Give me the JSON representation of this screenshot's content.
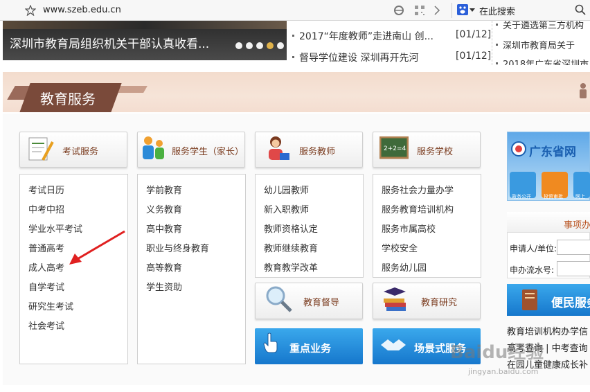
{
  "browser": {
    "url": "www.szeb.edu.cn",
    "search_placeholder": "在此搜索"
  },
  "top_news": {
    "banner_caption": "深圳市教育局组织机关干部认真收看...",
    "middle": [
      {
        "title": "2017“年度教师”走进南山 创...",
        "date": "[01/12]"
      },
      {
        "title": "督导学位建设 深圳再开先河",
        "date": "[01/12]"
      }
    ],
    "right": [
      "关于遴选第三方机构",
      "深圳市教育局关于",
      "2018年广东省深圳市"
    ]
  },
  "section": {
    "title": "教育服务"
  },
  "categories": [
    {
      "label": "考试服务",
      "items": [
        "考试日历",
        "中考中招",
        "学业水平考试",
        "普通高考",
        "成人高考",
        "自学考试",
        "研究生考试",
        "社会考试"
      ]
    },
    {
      "label": "服务学生（家长）",
      "items": [
        "学前教育",
        "义务教育",
        "高中教育",
        "职业与终身教育",
        "高等教育",
        "学生资助"
      ]
    },
    {
      "label": "服务教师",
      "items": [
        "幼儿园教师",
        "新入职教师",
        "教师资格认定",
        "教师继续教育",
        "教育教学改革"
      ]
    },
    {
      "label": "服务学校",
      "items": [
        "服务社会力量办学",
        "服务教育培训机构",
        "服务市属高校",
        "学校安全",
        "服务幼儿园"
      ]
    }
  ],
  "secondary": {
    "supervision": "教育督导",
    "research": "教育研究",
    "key_business": "重点业务",
    "scenario_service": "场景式服务"
  },
  "right_panel": {
    "gd_title": "广东省网",
    "mini_icons": [
      "政务公开",
      "投资审批",
      "网上"
    ],
    "query_title": "事项办",
    "applicant_label": "申请人/单位:",
    "serial_label": "申办流水号:",
    "convenience": "便民服务",
    "links": [
      "教育培训机构办学信",
      "高考查询 | 中考查询",
      "在园儿童健康成长补"
    ]
  },
  "watermark": {
    "main": "Baidu经验",
    "sub": "jingyan.baidu.com"
  },
  "colors": {
    "accent_brown": "#7a3b1e",
    "button_blue": "#1f86d8",
    "band_pink": "#f3dccd",
    "arrow_red": "#e02020"
  }
}
